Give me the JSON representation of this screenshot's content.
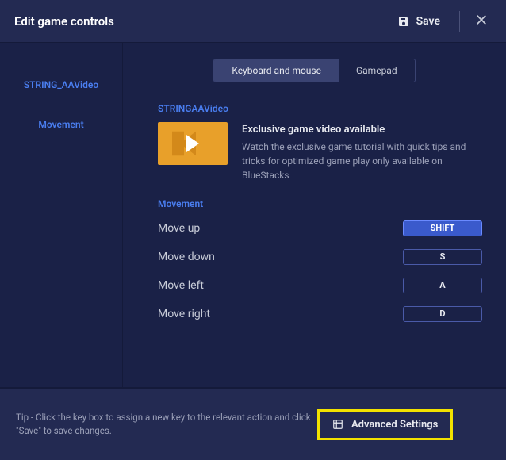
{
  "header": {
    "title": "Edit game controls",
    "save_label": "Save"
  },
  "sidebar": {
    "items": [
      {
        "label": "STRING_AAVideo"
      },
      {
        "label": "Movement"
      }
    ]
  },
  "tabs": {
    "keyboard": "Keyboard and mouse",
    "gamepad": "Gamepad"
  },
  "video": {
    "section_title": "STRINGAAVideo",
    "heading": "Exclusive game video available",
    "body": "Watch the exclusive game tutorial with quick tips and tricks for optimized game play only available on BlueStacks"
  },
  "movement": {
    "section_title": "Movement",
    "rows": [
      {
        "label": "Move up",
        "key": "SHIFT",
        "selected": true
      },
      {
        "label": "Move down",
        "key": "S",
        "selected": false
      },
      {
        "label": "Move left",
        "key": "A",
        "selected": false
      },
      {
        "label": "Move right",
        "key": "D",
        "selected": false
      }
    ]
  },
  "footer": {
    "tip": "Tip - Click the key box to assign a new key to the relevant action and click \"Save\" to save changes.",
    "advanced_label": "Advanced Settings"
  }
}
